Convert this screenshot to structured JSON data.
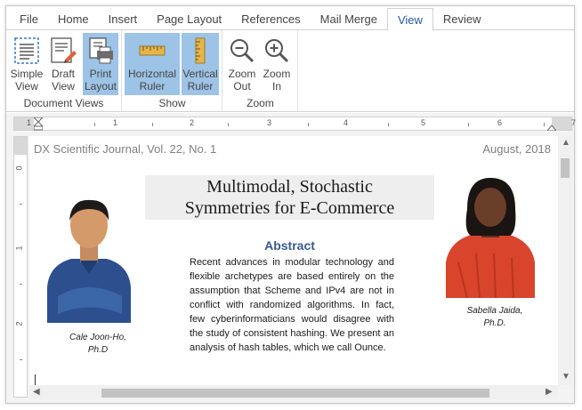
{
  "tabs": [
    {
      "label": "File",
      "active": false
    },
    {
      "label": "Home",
      "active": false
    },
    {
      "label": "Insert",
      "active": false
    },
    {
      "label": "Page Layout",
      "active": false
    },
    {
      "label": "References",
      "active": false
    },
    {
      "label": "Mail Merge",
      "active": false
    },
    {
      "label": "View",
      "active": true
    },
    {
      "label": "Review",
      "active": false
    }
  ],
  "ribbon": {
    "document_views": {
      "label": "Document Views",
      "simple_line1": "Simple",
      "simple_line2": "View",
      "draft_line1": "Draft",
      "draft_line2": "View",
      "print_line1": "Print",
      "print_line2": "Layout"
    },
    "show": {
      "label": "Show",
      "hruler_line1": "Horizontal",
      "hruler_line2": "Ruler",
      "vruler_line1": "Vertical",
      "vruler_line2": "Ruler"
    },
    "zoom": {
      "label": "Zoom",
      "out_line1": "Zoom",
      "out_line2": "Out",
      "in_line1": "Zoom",
      "in_line2": "In"
    }
  },
  "ruler": {
    "h_numbers": [
      "1",
      "1",
      "2",
      "3",
      "4",
      "5",
      "6",
      "7"
    ],
    "v_numbers": [
      "0",
      "1",
      "2"
    ]
  },
  "document": {
    "header_left": "DX Scientific Journal, Vol. 22, No. 1",
    "header_right": "August, 2018",
    "title_line1": "Multimodal, Stochastic",
    "title_line2": "Symmetries for E-Commerce",
    "abstract_title": "Abstract",
    "abstract_body": "Recent advances in modular technology and flexible archetypes are based entirely on the assumption that Scheme and IPv4 are not in conflict with randomized algorithms. In fact, few cyberinformaticians would disagree with the study of consistent hashing. We present an analysis of hash tables, which we call Ounce.",
    "author1_line1": "Cale Joon-Ho,",
    "author1_line2": "Ph.D",
    "author2_line1": "Sabella Jaida,",
    "author2_line2": "Ph.D."
  },
  "colors": {
    "accent": "#2b579a",
    "checked": "#9dc3e6",
    "abstract": "#3b5a8a"
  }
}
